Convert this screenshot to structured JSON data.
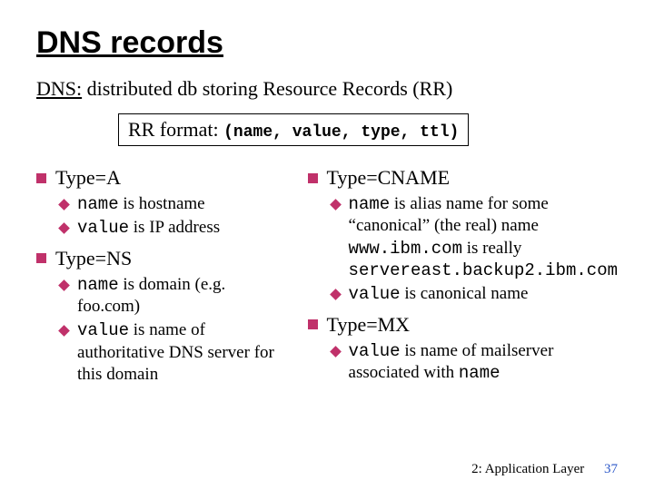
{
  "title": "DNS records",
  "subtitle_u": "DNS:",
  "subtitle_rest": " distributed db storing Resource Records (RR)",
  "format_label": "RR format: ",
  "format_tuple": "(name, value, type, ttl)",
  "left": {
    "a": {
      "heading": "Type=A",
      "b1_pre": "name",
      "b1_post": " is hostname",
      "b2_pre": "value",
      "b2_post": " is IP address"
    },
    "ns": {
      "heading": "Type=NS",
      "b1_pre": "name",
      "b1_post": " is domain (e.g. foo.com)",
      "b2_pre": "value",
      "b2_post": " is name of authoritative DNS server for this domain"
    }
  },
  "right": {
    "cname": {
      "heading": "Type=CNAME",
      "b1_pre": "name",
      "b1_mid": " is alias name for some “canonical” (the real) name",
      "b1_ex1": "www.ibm.com",
      "b1_ex_mid": " is really ",
      "b1_ex2": "servereast.backup2.ibm.com",
      "b2_pre": "value",
      "b2_post": " is canonical name"
    },
    "mx": {
      "heading": "Type=MX",
      "b1_pre": "value",
      "b1_post": " is name of mailserver associated with ",
      "b1_tail": "name"
    }
  },
  "footer": {
    "chapter": "2: Application Layer",
    "page": "37"
  }
}
